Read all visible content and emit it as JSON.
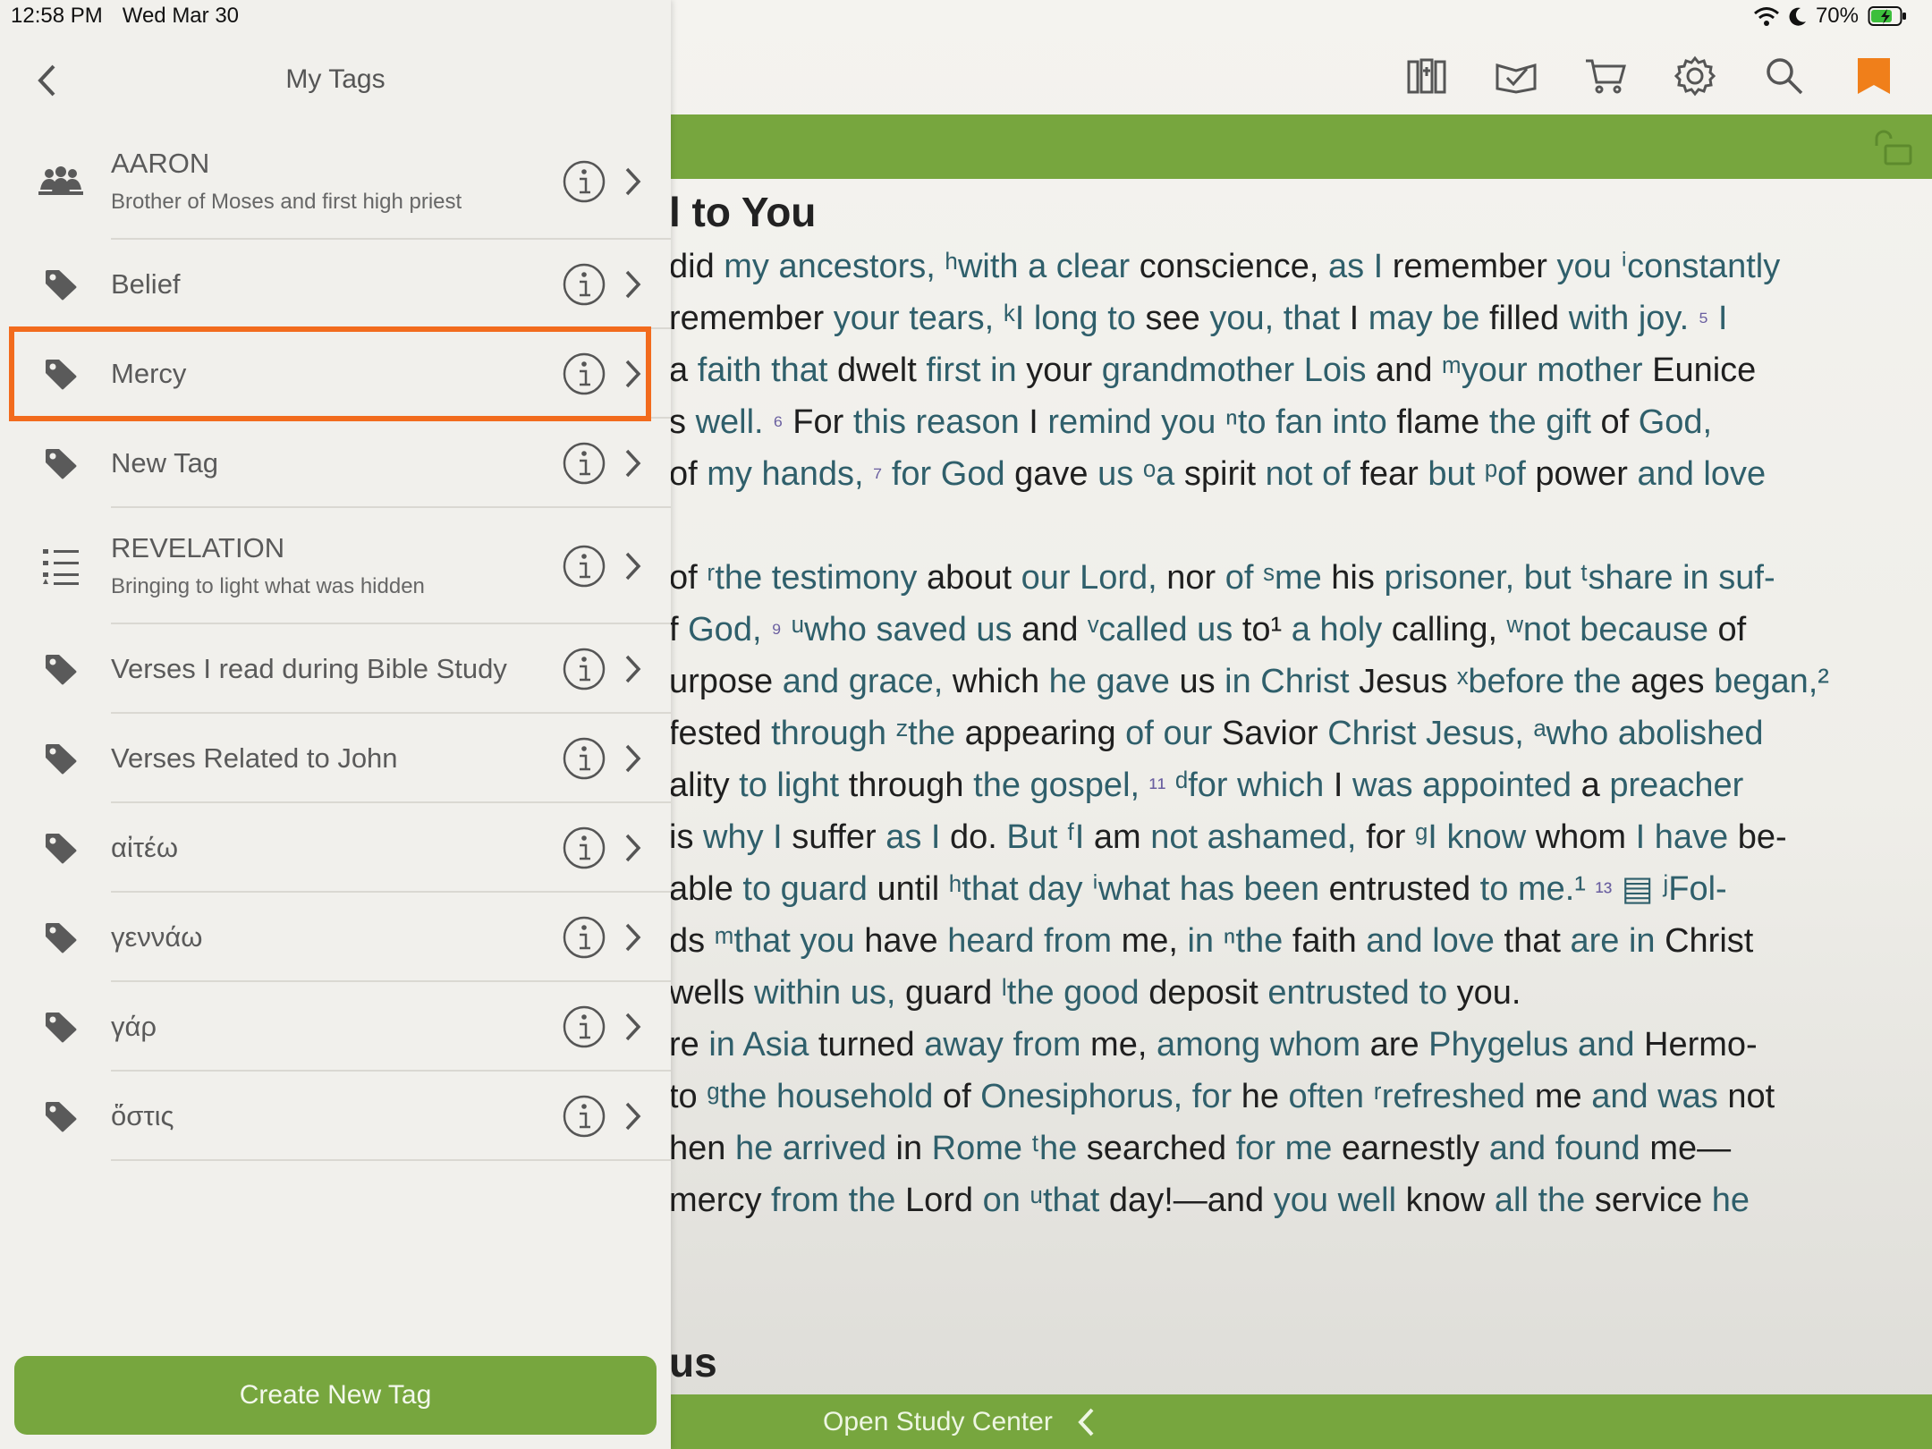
{
  "status": {
    "time": "12:58 PM",
    "date": "Wed Mar 30",
    "battery": "70%"
  },
  "panel": {
    "title": "My Tags",
    "create_label": "Create New Tag",
    "tags": [
      {
        "name": "AARON",
        "description": "Brother of Moses and first high priest",
        "icon": "people-icon"
      },
      {
        "name": "Belief",
        "description": "",
        "icon": "tag-icon"
      },
      {
        "name": "Mercy",
        "description": "",
        "icon": "tag-icon",
        "highlighted": true
      },
      {
        "name": "New Tag",
        "description": "",
        "icon": "tag-icon"
      },
      {
        "name": "REVELATION",
        "description": "Bringing to light what was hidden",
        "icon": "outline-icon"
      },
      {
        "name": "Verses I read during  Bible Study",
        "description": "",
        "icon": "tag-icon"
      },
      {
        "name": "Verses Related to John",
        "description": "",
        "icon": "tag-icon"
      },
      {
        "name": "αἰτέω",
        "description": "",
        "icon": "tag-icon"
      },
      {
        "name": "γεννάω",
        "description": "",
        "icon": "tag-icon"
      },
      {
        "name": "γάρ",
        "description": "",
        "icon": "tag-icon"
      },
      {
        "name": "ὅστις",
        "description": "",
        "icon": "tag-icon"
      }
    ]
  },
  "toolbar": {
    "icons": [
      "library-icon",
      "reading-plan-icon",
      "cart-icon",
      "gear-icon",
      "search-icon",
      "bookmark-icon"
    ]
  },
  "reader": {
    "heading": "l to You",
    "lines": [
      "did my ancestors, ʰwith a clear conscience, as I remember you ⁱconstantly",
      "remember your tears, ᵏI long to see you, that I may be filled with joy.  ⁵ I",
      "a faith that dwelt first in your grandmother Lois and ᵐyour mother Eunice",
      "s well.  ⁶ For this reason I remind you ⁿto fan into flame the gift of God,",
      "of my hands,  ⁷ for God gave us ᵒa spirit not of fear but ᵖof power and love",
      "",
      "of ʳthe testimony about our Lord, nor of ˢme his prisoner, but ᵗshare in suf-",
      "f God,  ⁹ ᵘwho saved us and ᵛcalled us to¹ a holy calling, ʷnot because of",
      "urpose and grace, which he gave us in Christ Jesus ˣbefore the ages began,²",
      "fested through ᶻthe appearing of our Savior Christ Jesus, ᵃwho abolished",
      "ality to light through the gospel,  ¹¹ ᵈfor which I was appointed a preacher",
      "is why I suffer as I do. But ᶠI am not ashamed, for ᵍI know whom I have be-",
      "able to guard until ʰthat day ⁱwhat has been entrusted to me.¹  ¹³ ▤  ʲFol-",
      "ds ᵐthat you have heard from me, in ⁿthe faith and love that are in Christ",
      "wells within us, guard ˡthe good deposit entrusted to you.",
      "re in Asia turned away from me, among whom are Phygelus and Hermo-",
      "to ᵍthe household of Onesiphorus, for he often ʳrefreshed me and was not",
      "hen he arrived in Rome ᵗhe searched for me earnestly and found me—",
      "mercy from the Lord on ᵘthat day!—and you well know all the service he"
    ],
    "heading2": "us",
    "study_label": "Open Study Center"
  },
  "colors": {
    "accent": "#77a63e",
    "highlight": "#f26b1d",
    "link": "#2f5f6b",
    "bookmark": "#f07f1a"
  }
}
